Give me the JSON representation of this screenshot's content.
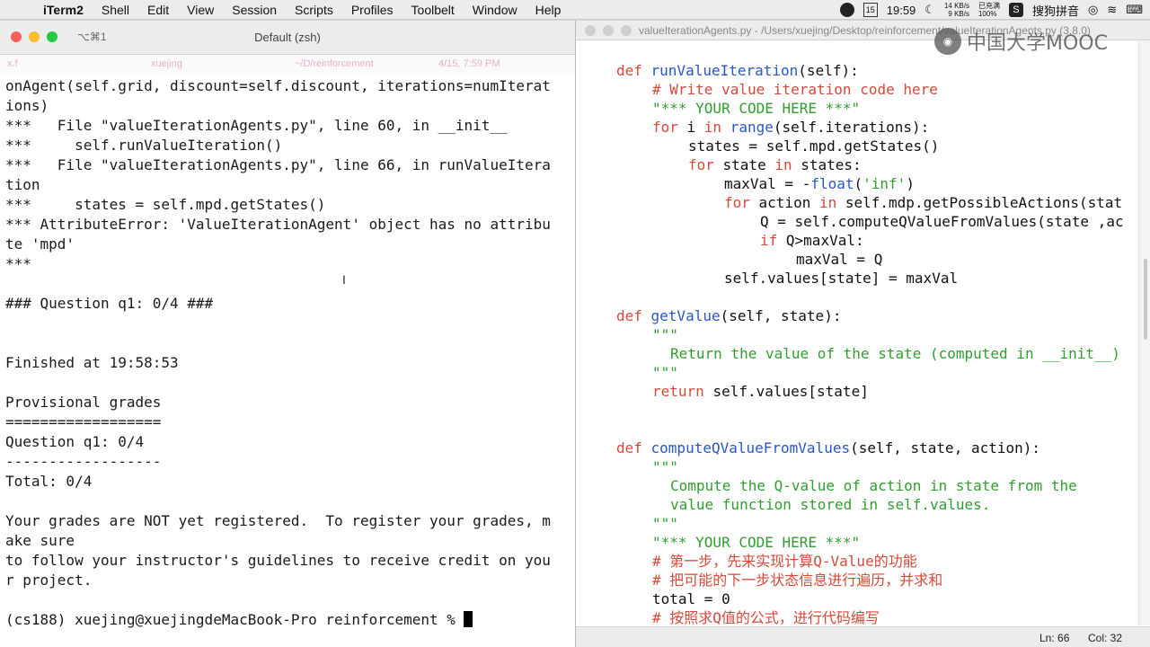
{
  "menubar": {
    "app_name": "iTerm2",
    "items": [
      "Shell",
      "Edit",
      "View",
      "Session",
      "Scripts",
      "Profiles",
      "Toolbelt",
      "Window",
      "Help"
    ],
    "calendar_day": "15",
    "clock": "19:59",
    "net_up": "14 KB/s",
    "net_down": "9 KB/s",
    "battery_status": "已充满",
    "battery_pct": "100%",
    "ime_label": "搜狗拼音"
  },
  "terminal": {
    "shortcut": "⌥⌘1",
    "title": "Default (zsh)",
    "status": {
      "host_short": "x.f",
      "user": "xuejing",
      "dir": "~/D/reinforcement",
      "datetime": "4/15, 7:59 PM"
    },
    "lines": [
      "onAgent(self.grid, discount=self.discount, iterations=numIterat",
      "ions)",
      "***   File \"valueIterationAgents.py\", line 60, in __init__",
      "***     self.runValueIteration()",
      "***   File \"valueIterationAgents.py\", line 66, in runValueItera",
      "tion",
      "***     states = self.mpd.getStates()",
      "*** AttributeError: 'ValueIterationAgent' object has no attribu",
      "te 'mpd'",
      "***",
      "",
      "### Question q1: 0/4 ###",
      "",
      "",
      "Finished at 19:58:53",
      "",
      "Provisional grades",
      "==================",
      "Question q1: 0/4",
      "------------------",
      "Total: 0/4",
      "",
      "Your grades are NOT yet registered.  To register your grades, m",
      "ake sure",
      "to follow your instructor's guidelines to receive credit on you",
      "r project.",
      "",
      "(cs188) xuejing@xuejingdeMacBook-Pro reinforcement % "
    ]
  },
  "editor": {
    "title": "valueIterationAgents.py - /Users/xuejing/Desktop/reinforcement/valueIterationAgents.py (3.8.0)",
    "status_line": "Ln: 66",
    "status_col": "Col: 32",
    "code": [
      {
        "indent": 0,
        "parts": [
          [
            "kw",
            "def "
          ],
          [
            "fn",
            "runValueIteration"
          ],
          [
            "",
            "(self):"
          ]
        ]
      },
      {
        "indent": 4,
        "parts": [
          [
            "cm",
            "# Write value iteration code here"
          ]
        ]
      },
      {
        "indent": 4,
        "parts": [
          [
            "st",
            "\"*** YOUR CODE HERE ***\""
          ]
        ]
      },
      {
        "indent": 4,
        "parts": [
          [
            "kw",
            "for "
          ],
          [
            "",
            "i "
          ],
          [
            "kw",
            "in "
          ],
          [
            "fn",
            "range"
          ],
          [
            "",
            "(self.iterations):"
          ]
        ]
      },
      {
        "indent": 8,
        "parts": [
          [
            "",
            "states = self.mpd.getStates()"
          ]
        ]
      },
      {
        "indent": 8,
        "parts": [
          [
            "kw",
            "for "
          ],
          [
            "",
            "state "
          ],
          [
            "kw",
            "in "
          ],
          [
            "",
            "states:"
          ]
        ]
      },
      {
        "indent": 12,
        "parts": [
          [
            "",
            "maxVal = -"
          ],
          [
            "fn",
            "float"
          ],
          [
            "",
            "("
          ],
          [
            "st",
            "'inf'"
          ],
          [
            "",
            ")"
          ]
        ]
      },
      {
        "indent": 12,
        "parts": [
          [
            "kw",
            "for "
          ],
          [
            "",
            "action "
          ],
          [
            "kw",
            "in "
          ],
          [
            "",
            "self.mdp.getPossibleActions(stat"
          ]
        ]
      },
      {
        "indent": 16,
        "parts": [
          [
            "",
            "Q = self.computeQValueFromValues(state ,ac"
          ]
        ]
      },
      {
        "indent": 16,
        "parts": [
          [
            "kw",
            "if "
          ],
          [
            "",
            "Q>maxVal:"
          ]
        ]
      },
      {
        "indent": 20,
        "parts": [
          [
            "",
            "maxVal = Q"
          ]
        ]
      },
      {
        "indent": 12,
        "parts": [
          [
            "",
            "self.values[state] = maxVal"
          ]
        ]
      },
      {
        "indent": 0,
        "parts": [
          [
            "",
            ""
          ]
        ]
      },
      {
        "indent": 0,
        "parts": [
          [
            "kw",
            "def "
          ],
          [
            "fn",
            "getValue"
          ],
          [
            "",
            "(self, state):"
          ]
        ]
      },
      {
        "indent": 4,
        "parts": [
          [
            "st",
            "\"\"\""
          ]
        ]
      },
      {
        "indent": 6,
        "parts": [
          [
            "st",
            "Return the value of the state (computed in __init__)"
          ]
        ]
      },
      {
        "indent": 4,
        "parts": [
          [
            "st",
            "\"\"\""
          ]
        ]
      },
      {
        "indent": 4,
        "parts": [
          [
            "kw",
            "return "
          ],
          [
            "",
            "self.values[state]"
          ]
        ]
      },
      {
        "indent": 0,
        "parts": [
          [
            "",
            ""
          ]
        ]
      },
      {
        "indent": 0,
        "parts": [
          [
            "",
            ""
          ]
        ]
      },
      {
        "indent": 0,
        "parts": [
          [
            "kw",
            "def "
          ],
          [
            "fn",
            "computeQValueFromValues"
          ],
          [
            "",
            "(self, state, action):"
          ]
        ]
      },
      {
        "indent": 4,
        "parts": [
          [
            "st",
            "\"\"\""
          ]
        ]
      },
      {
        "indent": 6,
        "parts": [
          [
            "st",
            "Compute the Q-value of action in state from the"
          ]
        ]
      },
      {
        "indent": 6,
        "parts": [
          [
            "st",
            "value function stored in self.values."
          ]
        ]
      },
      {
        "indent": 4,
        "parts": [
          [
            "st",
            "\"\"\""
          ]
        ]
      },
      {
        "indent": 4,
        "parts": [
          [
            "st",
            "\"*** YOUR CODE HERE ***\""
          ]
        ]
      },
      {
        "indent": 4,
        "parts": [
          [
            "cm",
            "# 第一步，先来实现计算Q-Value的功能"
          ]
        ]
      },
      {
        "indent": 4,
        "parts": [
          [
            "cm",
            "# 把可能的下一步状态信息进行遍历，并求和"
          ]
        ]
      },
      {
        "indent": 4,
        "parts": [
          [
            "",
            "total = 0"
          ]
        ]
      },
      {
        "indent": 4,
        "parts": [
          [
            "cm",
            "# 按照求Q值的公式，进行代码编写"
          ]
        ]
      }
    ]
  },
  "watermark": {
    "text": "中国大学MOOC"
  }
}
